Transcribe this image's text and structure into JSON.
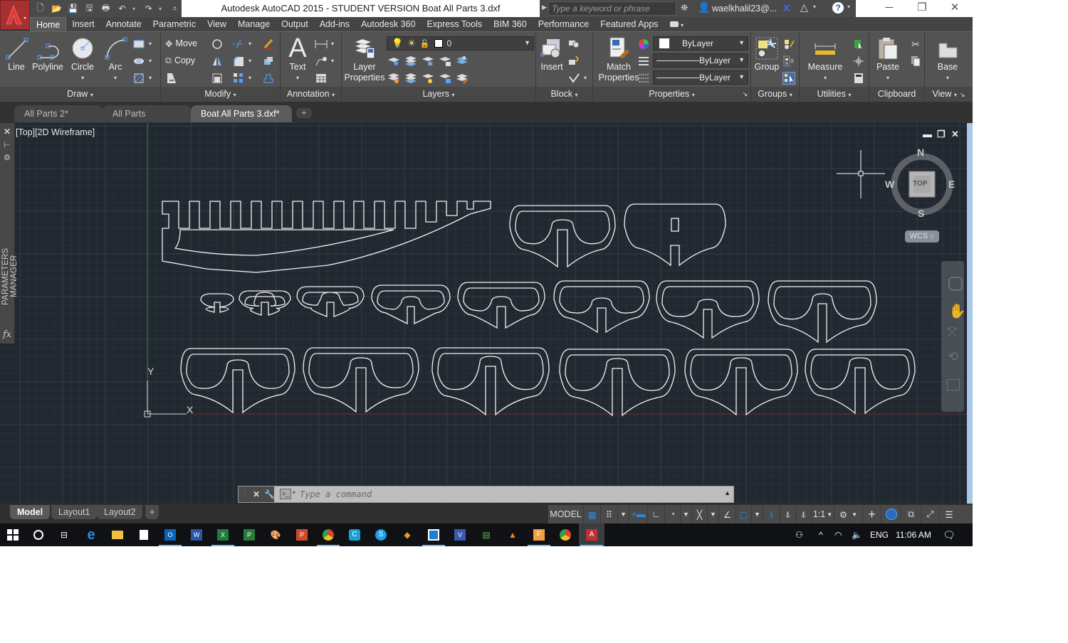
{
  "window": {
    "title": "Autodesk AutoCAD 2015 - STUDENT VERSION    Boat All Parts 3.dxf",
    "search_placeholder": "Type a keyword or phrase",
    "user": "waelkhalil23@...",
    "controls": [
      "minimize",
      "restore",
      "close"
    ]
  },
  "quick_access": [
    "new",
    "open",
    "save",
    "save-as",
    "plot",
    "undo",
    "redo",
    "customize"
  ],
  "ribbon_tabs": [
    {
      "label": "Home",
      "active": true
    },
    {
      "label": "Insert"
    },
    {
      "label": "Annotate"
    },
    {
      "label": "Parametric"
    },
    {
      "label": "View"
    },
    {
      "label": "Manage"
    },
    {
      "label": "Output"
    },
    {
      "label": "Add-ins"
    },
    {
      "label": "Autodesk 360"
    },
    {
      "label": "Express Tools"
    },
    {
      "label": "BIM 360"
    },
    {
      "label": "Performance"
    },
    {
      "label": "Featured Apps"
    }
  ],
  "ribbon": {
    "draw": {
      "title": "Draw",
      "line": "Line",
      "polyline": "Polyline",
      "circle": "Circle",
      "arc": "Arc"
    },
    "modify": {
      "title": "Modify",
      "move": "Move",
      "copy": "Copy"
    },
    "annotation": {
      "title": "Annotation",
      "text": "Text"
    },
    "layers": {
      "title": "Layers",
      "layer_properties_1": "Layer",
      "layer_properties_2": "Properties",
      "current_layer": "0"
    },
    "block": {
      "title": "Block",
      "insert": "Insert"
    },
    "properties": {
      "title": "Properties",
      "match_1": "Match",
      "match_2": "Properties",
      "color": "ByLayer",
      "lineweight": "ByLayer",
      "linetype": "ByLayer"
    },
    "groups": {
      "title": "Groups",
      "group": "Group"
    },
    "utilities": {
      "title": "Utilities",
      "measure": "Measure"
    },
    "clipboard": {
      "title": "Clipboard",
      "paste": "Paste"
    },
    "view": {
      "title": "View",
      "base": "Base"
    }
  },
  "file_tabs": [
    {
      "label": "All Parts 2*"
    },
    {
      "label": "All Parts"
    },
    {
      "label": "Boat All Parts 3.dxf*",
      "active": true
    }
  ],
  "viewport": {
    "label": "[Top][2D Wireframe]",
    "parameters_manager": "PARAMETERS MANAGER",
    "fx": "fx",
    "viewcube": {
      "face": "TOP",
      "n": "N",
      "s": "S",
      "e": "E",
      "w": "W"
    },
    "wcs": "WCS",
    "ucs": {
      "x": "X",
      "y": "Y"
    }
  },
  "command_line": {
    "placeholder": "Type a command"
  },
  "layout_tabs": [
    {
      "label": "Model",
      "active": true
    },
    {
      "label": "Layout1"
    },
    {
      "label": "Layout2"
    }
  ],
  "status_bar": {
    "model": "MODEL",
    "scale": "1:1"
  },
  "taskbar": {
    "apps": [
      "start",
      "cortana",
      "task-view",
      "edge",
      "file-explorer",
      "store",
      "outlook",
      "word",
      "excel",
      "project",
      "paint",
      "powerpoint",
      "chrome",
      "cc",
      "skype",
      "git",
      "app-box",
      "visio",
      "network-app",
      "vlc",
      "firefox-f",
      "chrome-2",
      "autocad"
    ],
    "language": "ENG",
    "time": "11:06 AM"
  },
  "colors": {
    "canvas_bg": "#212830",
    "ribbon_bg": "#535353",
    "accent_blue": "#2a8ae0",
    "autocad_red": "#a73030"
  }
}
